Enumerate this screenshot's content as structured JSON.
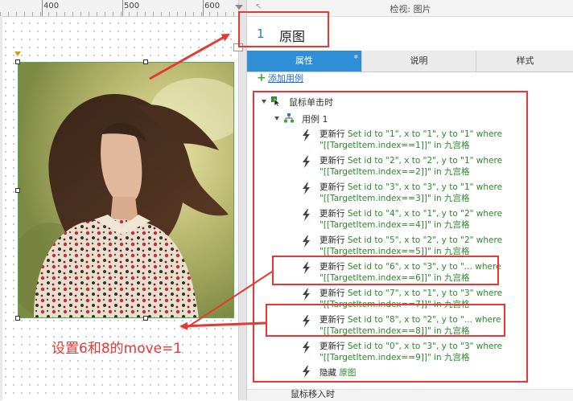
{
  "ruler": {
    "ticks": [
      "400",
      "500",
      "600"
    ]
  },
  "panel": {
    "title": "检视: 图片",
    "widget_number": "1",
    "widget_name": "原图",
    "tabs": [
      {
        "label": "属性",
        "modified_marker": "*"
      },
      {
        "label": "说明"
      },
      {
        "label": "样式"
      }
    ],
    "add_case_label": "添加用例"
  },
  "interactions": {
    "event_label": "鼠标单击时",
    "case_label": "用例 1",
    "actions": [
      {
        "name": "更新行",
        "line1": "Set id to \"1\", x to \"1\", y to \"1\" where",
        "line2": "\"[[TargetItem.index==1]]\" in 九宫格"
      },
      {
        "name": "更新行",
        "line1": "Set id to \"2\", x to \"2\", y to \"1\" where",
        "line2": "\"[[TargetItem.index==2]]\" in 九宫格"
      },
      {
        "name": "更新行",
        "line1": "Set id to \"3\", x to \"3\", y to \"1\" where",
        "line2": "\"[[TargetItem.index==3]]\" in 九宫格"
      },
      {
        "name": "更新行",
        "line1": "Set id to \"4\", x to \"1\", y to \"2\" where",
        "line2": "\"[[TargetItem.index==4]]\" in 九宫格"
      },
      {
        "name": "更新行",
        "line1": "Set id to \"5\", x to \"2\", y to \"2\" where",
        "line2": "\"[[TargetItem.index==5]]\" in 九宫格"
      },
      {
        "name": "更新行",
        "line1": "Set id to \"6\", x to \"3\", y to \"... where",
        "line2": "\"[[TargetItem.index==6]]\" in 九宫格"
      },
      {
        "name": "更新行",
        "line1": "Set id to \"7\", x to \"1\", y to \"3\" where",
        "line2": "\"[[TargetItem.index==7]]\" in 九宫格"
      },
      {
        "name": "更新行",
        "line1": "Set id to \"8\", x to \"2\", y to \"... where",
        "line2": "\"[[TargetItem.index==8]]\" in 九宫格"
      },
      {
        "name": "更新行",
        "line1": "Set id to \"0\", x to \"3\", y to \"3\" where",
        "line2": "\"[[TargetItem.index==9]]\" in 九宫格"
      }
    ],
    "hide_action": {
      "name": "隐藏",
      "target": "原图"
    },
    "next_event_label": "鼠标移入时"
  },
  "annotation": {
    "text": "设置6和8的move=1"
  },
  "colors": {
    "accent": "#2e8ed6",
    "annotation_red": "#e53935",
    "action_green": "#2a8a2a",
    "link_blue": "#1e6ec8"
  },
  "icons": {
    "event": "cursor-click-icon",
    "case": "flowchart-icon",
    "action": "lightning-bolt-icon",
    "add": "plus-icon"
  }
}
